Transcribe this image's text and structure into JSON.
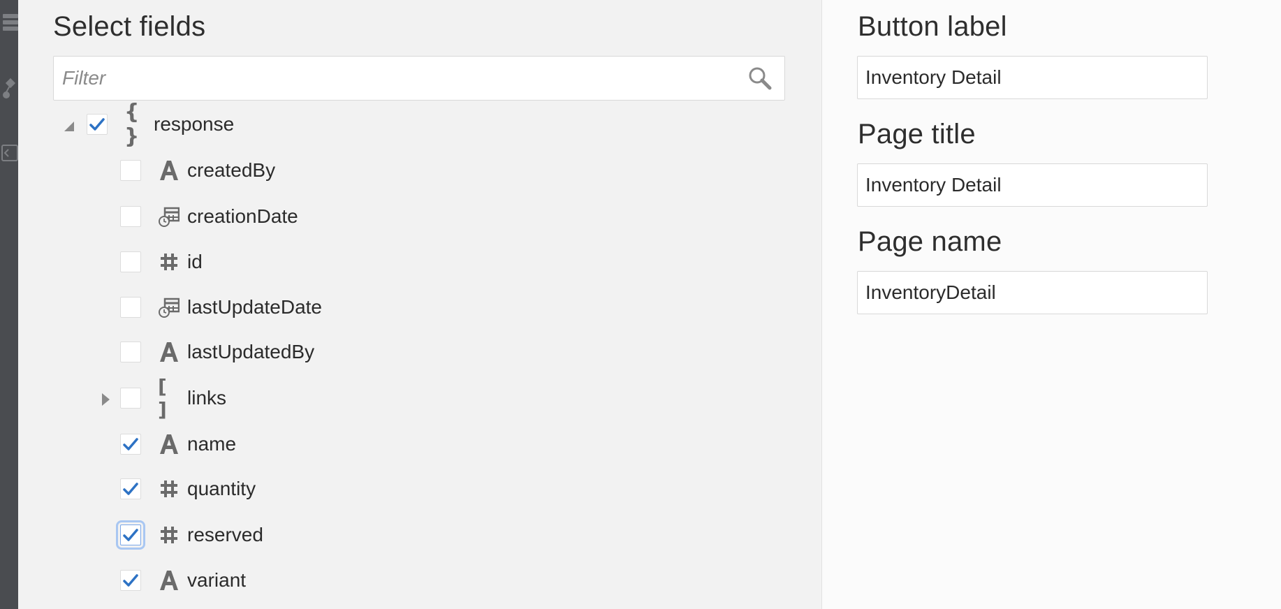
{
  "select_fields": {
    "title": "Select fields",
    "filter_placeholder": "Filter",
    "tree": {
      "root": {
        "label": "response",
        "icon": "object-braces-icon",
        "checked": true,
        "expanded": true
      },
      "children": [
        {
          "label": "createdBy",
          "type": "string",
          "icon": "string-type-icon",
          "checked": false
        },
        {
          "label": "creationDate",
          "type": "datetime",
          "icon": "datetime-type-icon",
          "checked": false
        },
        {
          "label": "id",
          "type": "number",
          "icon": "number-type-icon",
          "checked": false
        },
        {
          "label": "lastUpdateDate",
          "type": "datetime",
          "icon": "datetime-type-icon",
          "checked": false
        },
        {
          "label": "lastUpdatedBy",
          "type": "string",
          "icon": "string-type-icon",
          "checked": false
        },
        {
          "label": "links",
          "type": "array",
          "icon": "array-brackets-icon",
          "checked": false,
          "expandable": true,
          "expanded": false
        },
        {
          "label": "name",
          "type": "string",
          "icon": "string-type-icon",
          "checked": true
        },
        {
          "label": "quantity",
          "type": "number",
          "icon": "number-type-icon",
          "checked": true
        },
        {
          "label": "reserved",
          "type": "number",
          "icon": "number-type-icon",
          "checked": true,
          "focused": true
        },
        {
          "label": "variant",
          "type": "string",
          "icon": "string-type-icon",
          "checked": true
        }
      ]
    }
  },
  "settings": {
    "button_label": {
      "title": "Button label",
      "value": "Inventory Detail"
    },
    "page_title": {
      "title": "Page title",
      "value": "Inventory Detail"
    },
    "page_name": {
      "title": "Page name",
      "value": "InventoryDetail"
    }
  },
  "colors": {
    "check_blue": "#2d72c4",
    "focus_ring": "#a9c7f2",
    "icon_gray": "#6a6a6a",
    "left_panel_bg": "#f2f2f2",
    "right_panel_bg": "#fbfbfb",
    "side_strip": "#4a4c50"
  }
}
